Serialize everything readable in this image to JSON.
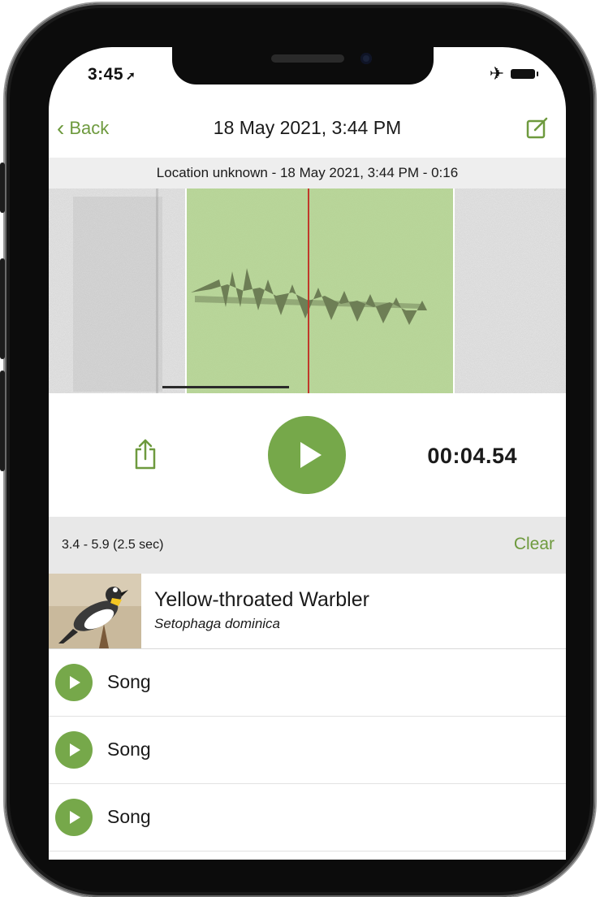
{
  "status": {
    "time": "3:45",
    "location_icon": "location-arrow-icon",
    "airplane_icon": "airplane-icon",
    "battery_icon": "battery-icon"
  },
  "nav": {
    "back_label": "Back",
    "title": "18 May 2021, 3:44 PM",
    "edit_icon": "edit-icon"
  },
  "recording": {
    "info": "Location unknown - 18 May 2021, 3:44 PM - 0:16"
  },
  "player": {
    "timer": "00:04.54",
    "share_icon": "share-icon",
    "play_icon": "play-icon"
  },
  "selection": {
    "range": "3.4 - 5.9 (2.5 sec)",
    "clear_label": "Clear"
  },
  "species": {
    "common_name": "Yellow-throated Warbler",
    "scientific_name": "Setophaga dominica"
  },
  "sounds": [
    {
      "label": "Song"
    },
    {
      "label": "Song"
    },
    {
      "label": "Song"
    }
  ],
  "colors": {
    "accent": "#76a84a",
    "accent_text": "#6e9a3e",
    "selection_highlight": "#a9d17e",
    "playhead": "#c0392b"
  }
}
